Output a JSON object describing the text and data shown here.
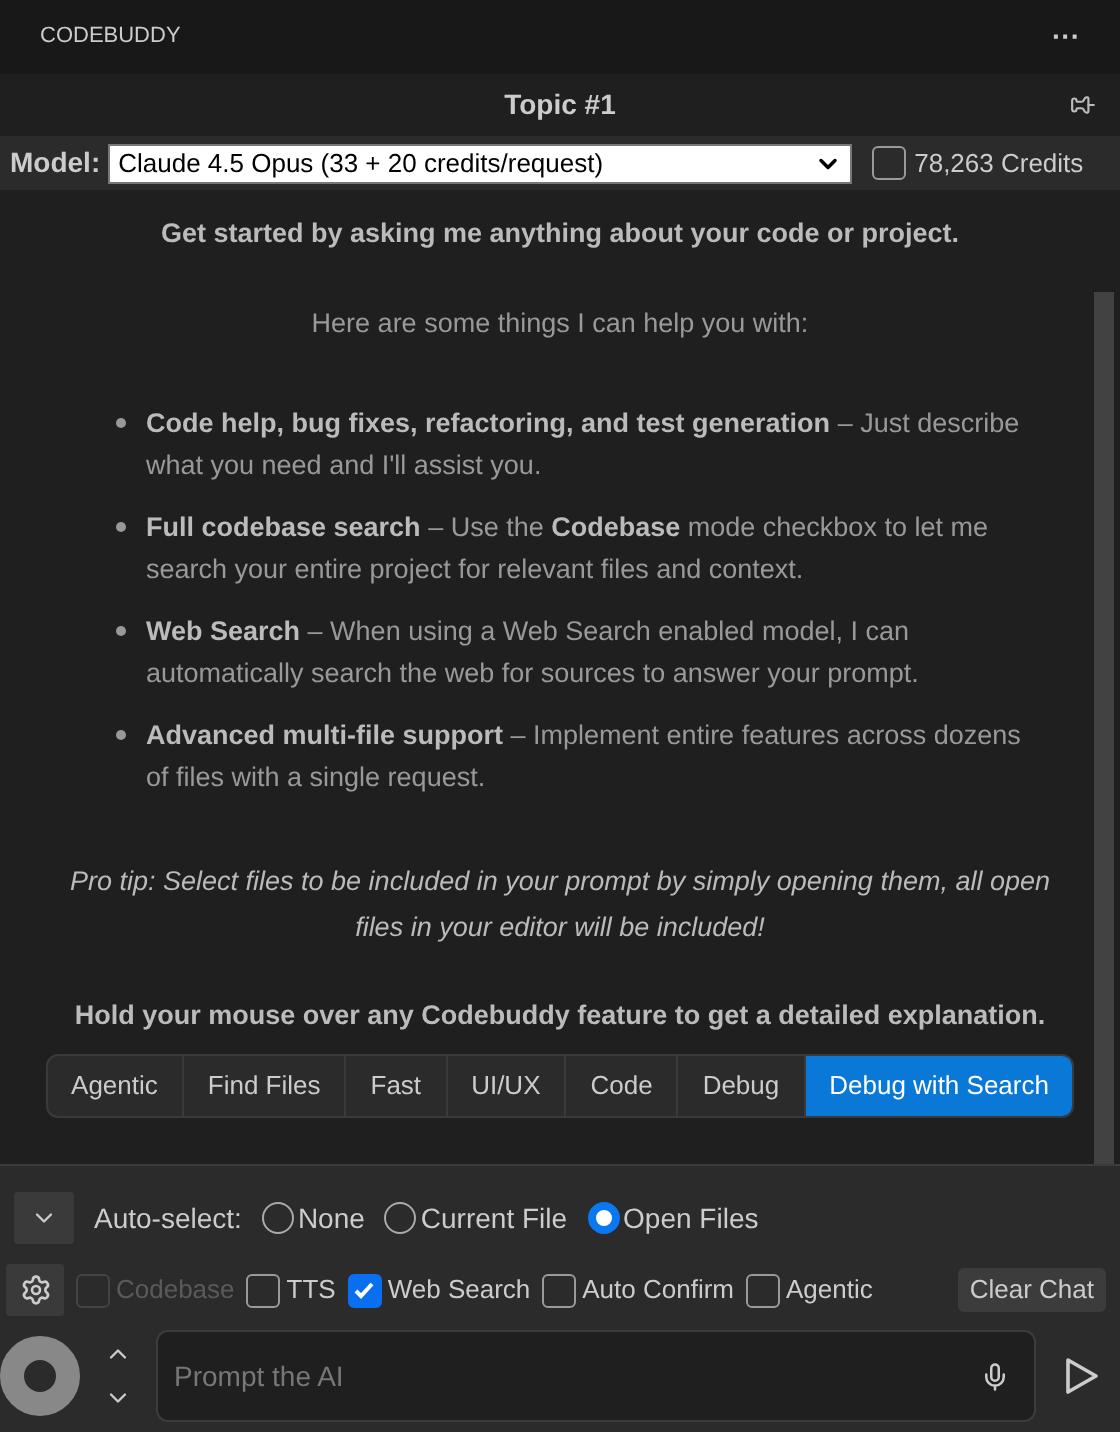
{
  "header": {
    "title": "CODEBUDDY",
    "menu": "···"
  },
  "topic": {
    "title": "Topic #1"
  },
  "model": {
    "label": "Model:",
    "value": "Claude 4.5 Opus (33 + 20 credits/request)",
    "credits_checked": false,
    "credits": "78,263 Credits"
  },
  "intro": "Get started by asking me anything about your code or project.",
  "help_heading": "Here are some things I can help you with:",
  "features": [
    {
      "text": "**Code help, bug fixes, refactoring, and test generation** – Just describe what you need and I'll assist you."
    },
    {
      "text": "**Full codebase search** – Use the **Codebase** mode checkbox to let me search your entire project for relevant files and context."
    },
    {
      "text": "**Web Search** – When using a Web Search enabled model, I can automatically search the web for sources to answer your prompt."
    },
    {
      "text": "**Advanced multi-file support** – Implement entire features across dozens of files with a single request."
    }
  ],
  "pro_tip": "Pro tip: Select files to be included in your prompt by simply opening them, all open files in your editor will be included!",
  "hover_hint": "Hold your mouse over any Codebuddy feature to get a detailed explanation.",
  "modes": [
    {
      "label": "Agentic",
      "selected": false
    },
    {
      "label": "Find Files",
      "selected": false
    },
    {
      "label": "Fast",
      "selected": false
    },
    {
      "label": "UI/UX",
      "selected": false
    },
    {
      "label": "Code",
      "selected": false
    },
    {
      "label": "Debug",
      "selected": false
    },
    {
      "label": "Debug with Search",
      "selected": true
    }
  ],
  "auto_select": {
    "label": "Auto-select:",
    "options": [
      {
        "label": "None",
        "selected": false
      },
      {
        "label": "Current File",
        "selected": false
      },
      {
        "label": "Open Files",
        "selected": true
      }
    ]
  },
  "options": [
    {
      "label": "Codebase",
      "checked": false,
      "disabled": true
    },
    {
      "label": "TTS",
      "checked": false,
      "disabled": false
    },
    {
      "label": "Web Search",
      "checked": true,
      "disabled": false
    },
    {
      "label": "Auto Confirm",
      "checked": false,
      "disabled": false
    },
    {
      "label": "Agentic",
      "checked": false,
      "disabled": false
    }
  ],
  "clear_button": "Clear Chat",
  "prompt": {
    "placeholder": "Prompt the AI"
  }
}
